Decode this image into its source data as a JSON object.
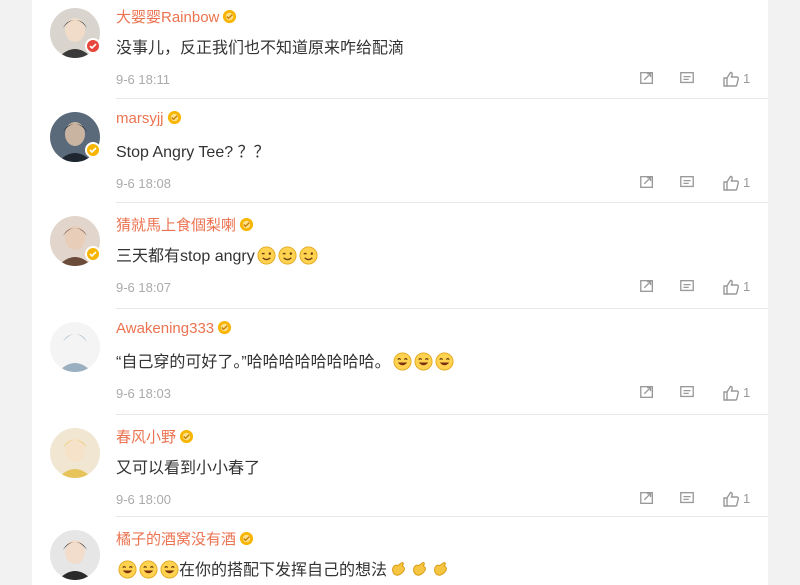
{
  "comments": [
    {
      "username": "大婴婴Rainbow",
      "text": "没事儿，反正我们也不知道原来咋给配滴",
      "time": "9-6 18:11",
      "likes": "1",
      "badge": "red",
      "emojis": []
    },
    {
      "username": "marsyjj",
      "text": "Stop Angry Tee? ？？",
      "time": "9-6 18:08",
      "likes": "1",
      "badge": "gold",
      "emojis": []
    },
    {
      "username": "猜就馬上食個梨喇",
      "text": "三天都有stop angry",
      "time": "9-6 18:07",
      "likes": "1",
      "badge": "gold",
      "emojis": [
        "wink-emoji",
        "wink-emoji",
        "wink-emoji"
      ]
    },
    {
      "username": "Awakening333",
      "text": "“自己穿的可好了。”哈哈哈哈哈哈哈哈。",
      "time": "9-6 18:03",
      "likes": "1",
      "badge": "none",
      "emojis": [
        "laugh-emoji",
        "laugh-emoji",
        "laugh-emoji"
      ]
    },
    {
      "username": "春风小野",
      "text": "又可以看到小小春了",
      "time": "9-6 18:00",
      "likes": "1",
      "badge": "none",
      "emojis": []
    },
    {
      "username": "橘子的酒窝没有酒",
      "text": "在你的搭配下发挥自己的想法",
      "time": "",
      "likes": "",
      "badge": "none",
      "emojis": [
        "laugh-emoji",
        "laugh-emoji",
        "laugh-emoji"
      ],
      "trailing_emojis": [
        "clap-emoji",
        "clap-emoji",
        "clap-emoji"
      ]
    }
  ],
  "icons": {
    "share": "share-icon",
    "reply": "comment-icon",
    "like": "thumbs-up-icon"
  },
  "colors": {
    "username": "#eb7350",
    "text": "#333333",
    "meta": "#aaaaaa",
    "badge_gold": "#f7b500",
    "badge_red": "#e8453c"
  }
}
